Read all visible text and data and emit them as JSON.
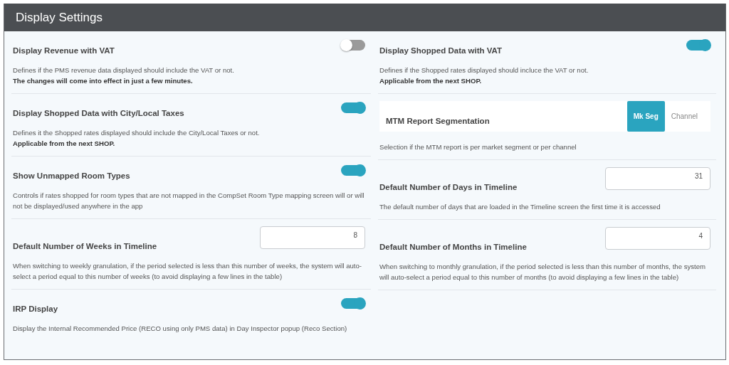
{
  "panel": {
    "title": "Display Settings"
  },
  "columns": [
    {
      "settings": [
        {
          "kind": "toggle",
          "title": "Display Revenue with VAT",
          "on": false,
          "description": "Defines if the PMS revenue data displayed should include the VAT or not.",
          "note": "The changes will come into effect in just a few minutes."
        },
        {
          "kind": "toggle",
          "title": "Display Shopped Data with City/Local Taxes",
          "on": true,
          "description": "Defines it the Shopped rates displayed should include the City/Local Taxes or not.",
          "note": "Applicable from the next SHOP."
        },
        {
          "kind": "toggle",
          "title": "Show Unmapped Room Types",
          "on": true,
          "description": "Controls if rates shopped for room types that are not mapped in the CompSet Room Type mapping screen will or will not be displayed/used anywhere in the app"
        },
        {
          "kind": "number",
          "title": "Default Number of Weeks in Timeline",
          "value": "8",
          "description": "When switching to weekly granulation, if the period selected is less than this number of weeks, the system will auto-select a period equal to this number of weeks (to avoid displaying a few lines in the table)"
        },
        {
          "kind": "toggle",
          "title": "IRP Display",
          "on": true,
          "description": "Display the Internal Recommended Price (RECO using only PMS data) in Day Inspector popup (Reco Section)"
        }
      ]
    },
    {
      "settings": [
        {
          "kind": "toggle",
          "title": "Display Shopped Data with VAT",
          "on": true,
          "description": "Defines if the Shopped rates displayed should incluce the VAT or not.",
          "note": "Applicable from the next SHOP."
        },
        {
          "kind": "segmented",
          "title": "MTM Report Segmentation",
          "options": [
            {
              "label": "Mk Seg",
              "selected": true
            },
            {
              "label": "Channel",
              "selected": false
            }
          ],
          "description": "Selection if the MTM report is per market segment or per channel"
        },
        {
          "kind": "number",
          "title": "Default Number of Days in Timeline",
          "value": "31",
          "description": "The default number of days that are loaded in the Timeline screen the first time it is accessed"
        },
        {
          "kind": "number",
          "title": "Default Number of Months in Timeline",
          "value": "4",
          "description": "When switching to monthly granulation, if the period selected is less than this number of months, the system will auto-select a period equal to this number of months (to avoid displaying a few lines in the table)"
        }
      ]
    }
  ]
}
